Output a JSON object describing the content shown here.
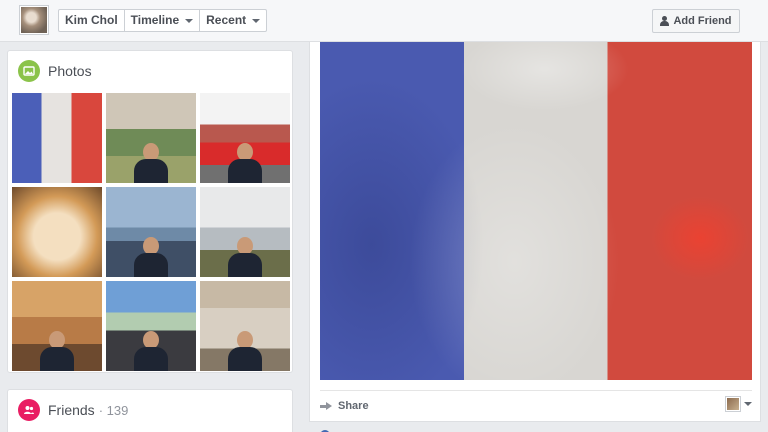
{
  "topbar": {
    "profile_name": "Kim Chol",
    "timeline_label": "Timeline",
    "recent_label": "Recent",
    "add_friend_label": "Add Friend"
  },
  "photos": {
    "title": "Photos",
    "icon": "photos-icon"
  },
  "friends": {
    "title": "Friends",
    "count": "· 139",
    "icon": "friends-icon"
  },
  "post": {
    "share_label": "Share",
    "audience_icon": "avatar"
  },
  "colors": {
    "flag_blue": "#4a5ab0",
    "flag_white": "#d8d6d2",
    "flag_red": "#d14a3e",
    "photos_accent": "#8bc34a",
    "friends_accent": "#e91e63"
  }
}
